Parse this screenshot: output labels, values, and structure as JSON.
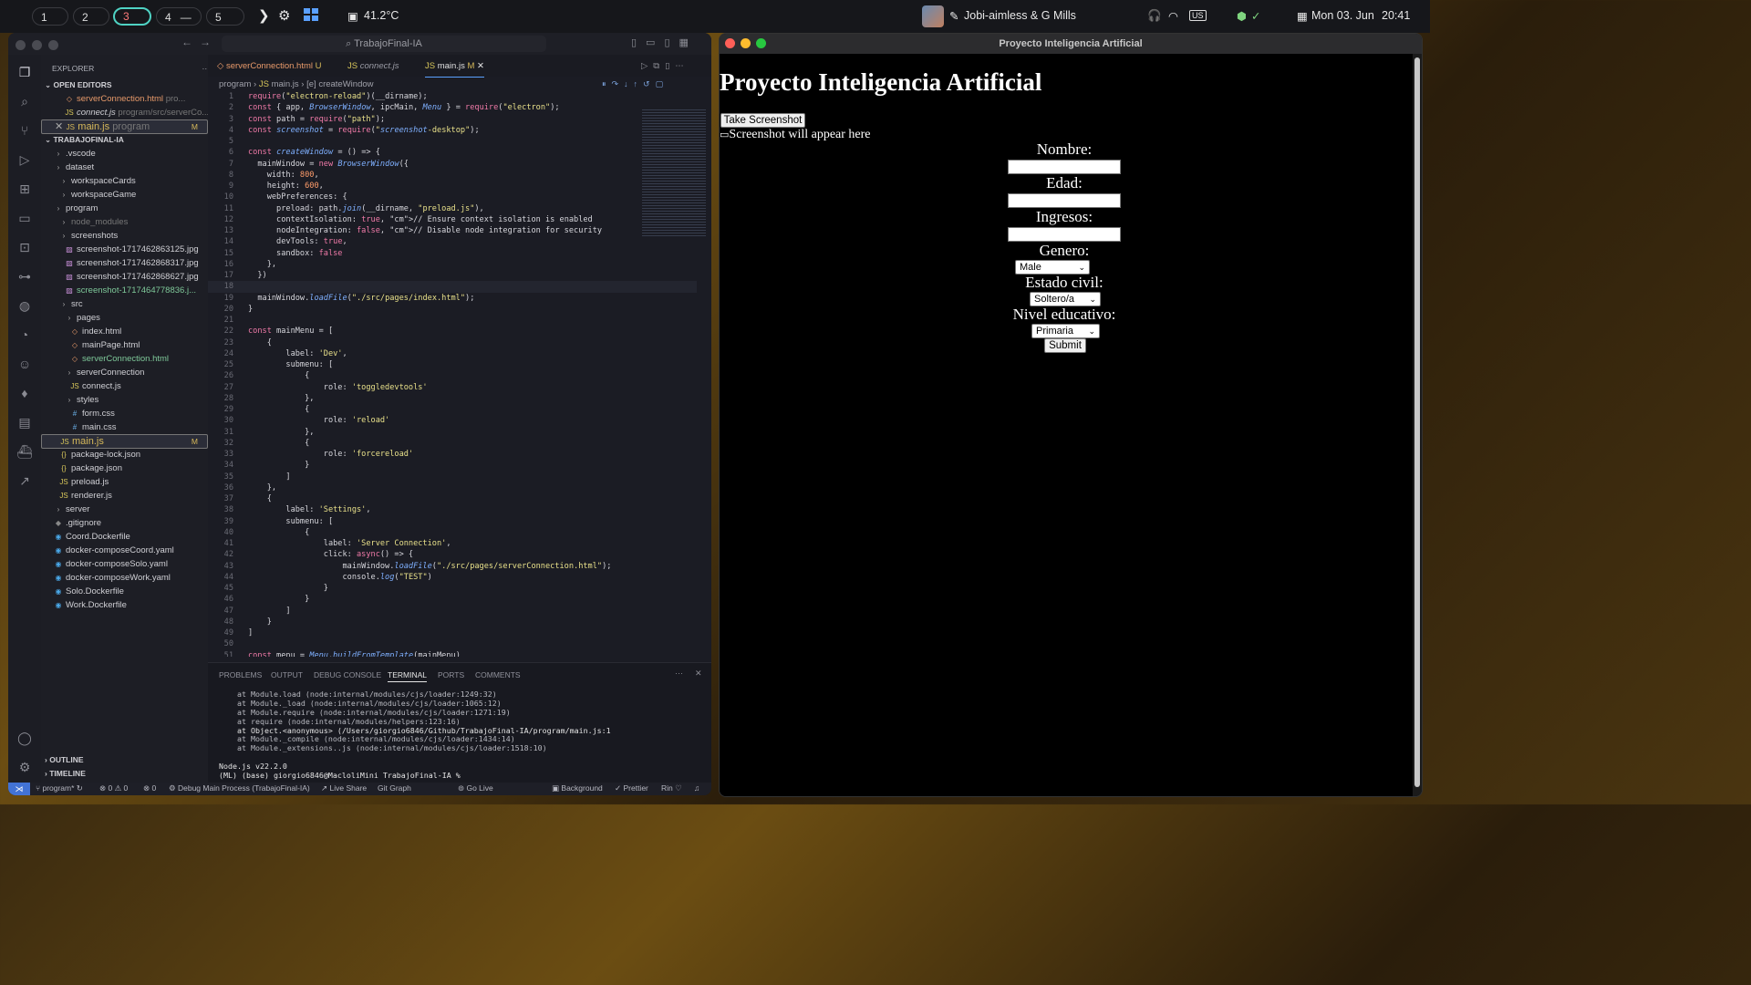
{
  "menubar": {
    "workspaces": [
      "1",
      "2",
      "3",
      "4",
      "5"
    ],
    "workspace4_extra": "—",
    "temperature": "41.2°C",
    "now_playing": "Jobi-aimless & G Mills",
    "keyboard": "US",
    "date": "Mon 03. Jun",
    "time": "20:41"
  },
  "vscode": {
    "command_center": "TrabajoFinal-IA",
    "explorer_title": "EXPLORER",
    "open_editors_title": "OPEN EDITORS",
    "open_editors": [
      {
        "name": "serverConnection.html",
        "path": "pro...",
        "badge": "U"
      },
      {
        "name": "connect.js",
        "path": "program/src/serverCo...",
        "badge": ""
      },
      {
        "name": "main.js",
        "path": "program",
        "badge": "M"
      }
    ],
    "project_title": "TRABAJOFINAL-IA",
    "tree": [
      {
        "name": ".vscode",
        "badge": ""
      },
      {
        "name": "dataset",
        "badge": ""
      },
      {
        "name": "workspaceCards",
        "badge": ""
      },
      {
        "name": "workspaceGame",
        "badge": ""
      },
      {
        "name": "program",
        "badge": ""
      },
      {
        "name": "node_modules",
        "badge": ""
      },
      {
        "name": "screenshots",
        "badge": ""
      },
      {
        "name": "screenshot-1717462863125.jpg",
        "badge": ""
      },
      {
        "name": "screenshot-1717462868317.jpg",
        "badge": ""
      },
      {
        "name": "screenshot-1717462868627.jpg",
        "badge": ""
      },
      {
        "name": "screenshot-1717464778836.j...",
        "badge": "U"
      },
      {
        "name": "src",
        "badge": ""
      },
      {
        "name": "pages",
        "badge": ""
      },
      {
        "name": "index.html",
        "badge": ""
      },
      {
        "name": "mainPage.html",
        "badge": ""
      },
      {
        "name": "serverConnection.html",
        "badge": "U"
      },
      {
        "name": "serverConnection",
        "badge": ""
      },
      {
        "name": "connect.js",
        "badge": ""
      },
      {
        "name": "styles",
        "badge": ""
      },
      {
        "name": "form.css",
        "badge": ""
      },
      {
        "name": "main.css",
        "badge": ""
      },
      {
        "name": "main.js",
        "badge": "M"
      },
      {
        "name": "package-lock.json",
        "badge": ""
      },
      {
        "name": "package.json",
        "badge": ""
      },
      {
        "name": "preload.js",
        "badge": ""
      },
      {
        "name": "renderer.js",
        "badge": ""
      },
      {
        "name": "server",
        "badge": ""
      },
      {
        "name": ".gitignore",
        "badge": ""
      },
      {
        "name": "Coord.Dockerfile",
        "badge": ""
      },
      {
        "name": "docker-composeCoord.yaml",
        "badge": ""
      },
      {
        "name": "docker-composeSolo.yaml",
        "badge": ""
      },
      {
        "name": "docker-composeWork.yaml",
        "badge": ""
      },
      {
        "name": "Solo.Dockerfile",
        "badge": ""
      },
      {
        "name": "Work.Dockerfile",
        "badge": ""
      }
    ],
    "outline": "OUTLINE",
    "timeline": "TIMELINE",
    "tabs": [
      {
        "label": "serverConnection.html",
        "badge": "U"
      },
      {
        "label": "connect.js",
        "badge": ""
      },
      {
        "label": "main.js",
        "badge": "M"
      }
    ],
    "breadcrumb": [
      "program",
      "main.js",
      "createWindow"
    ],
    "code": [
      "require(\"electron-reload\")(__dirname);",
      "const { app, BrowserWindow, ipcMain, Menu } = require(\"electron\");",
      "const path = require(\"path\");",
      "const screenshot = require(\"screenshot-desktop\");",
      "",
      "const createWindow = () => {",
      "  mainWindow = new BrowserWindow({",
      "    width: 800,",
      "    height: 600,",
      "    webPreferences: {",
      "      preload: path.join(__dirname, \"preload.js\"),",
      "      contextIsolation: true, // Ensure context isolation is enabled",
      "      nodeIntegration: false, // Disable node integration for security",
      "      devTools: true,",
      "      sandbox: false",
      "    },",
      "  })",
      "",
      "  mainWindow.loadFile(\"./src/pages/index.html\");",
      "}",
      "",
      "const mainMenu = [",
      "    {",
      "        label: 'Dev',",
      "        submenu: [",
      "            {",
      "                role: 'toggledevtools'",
      "            },",
      "            {",
      "                role: 'reload'",
      "            },",
      "            {",
      "                role: 'forcereload'",
      "            }",
      "        ]",
      "    },",
      "    {",
      "        label: 'Settings',",
      "        submenu: [",
      "            {",
      "                label: 'Server Connection',",
      "                click: async() => {",
      "                    mainWindow.loadFile(\"./src/pages/serverConnection.html\");",
      "                    console.log(\"TEST\")",
      "                }",
      "            }",
      "        ]",
      "    }",
      "]",
      "",
      "const menu = Menu.buildFromTemplate(mainMenu)"
    ],
    "panel_tabs": [
      "PROBLEMS",
      "OUTPUT",
      "DEBUG CONSOLE",
      "TERMINAL",
      "PORTS",
      "COMMENTS"
    ],
    "terminal": [
      "    at Module.load (node:internal/modules/cjs/loader:1249:32)",
      "    at Module._load (node:internal/modules/cjs/loader:1065:12)",
      "    at Module.require (node:internal/modules/cjs/loader:1271:19)",
      "    at require (node:internal/modules/helpers:123:16)",
      "    at Object.<anonymous> (/Users/giorgio6846/Github/TrabajoFinal-IA/program/main.js:1",
      "    at Module._compile (node:internal/modules/cjs/loader:1434:14)",
      "    at Module._extensions..js (node:internal/modules/cjs/loader:1518:10)",
      "",
      "Node.js v22.2.0",
      "(ML) (base) giorgio6846@MacloliMini TrabajoFinal-IA %"
    ],
    "status": {
      "branch": "program*",
      "problems": "⊗ 0 ⚠ 0",
      "ports": "0",
      "debug": "Debug Main Process (TrabajoFinal-IA)",
      "live_share": "Live Share",
      "git_graph": "Git Graph",
      "go_live": "Go Live",
      "background": "Background",
      "prettier": "Prettier",
      "rin": "Rin"
    }
  },
  "app": {
    "window_title": "Proyecto Inteligencia Artificial",
    "heading": "Proyecto Inteligencia Artificial",
    "screenshot_button": "Take Screenshot",
    "screenshot_alt": "Screenshot will appear here",
    "labels": {
      "nombre": "Nombre:",
      "edad": "Edad:",
      "ingresos": "Ingresos:",
      "genero": "Genero:",
      "estado_civil": "Estado civil:",
      "nivel_educativo": "Nivel educativo:"
    },
    "selects": {
      "genero": "Male",
      "estado_civil": "Soltero/a",
      "nivel_educativo": "Primaria"
    },
    "submit": "Submit"
  }
}
